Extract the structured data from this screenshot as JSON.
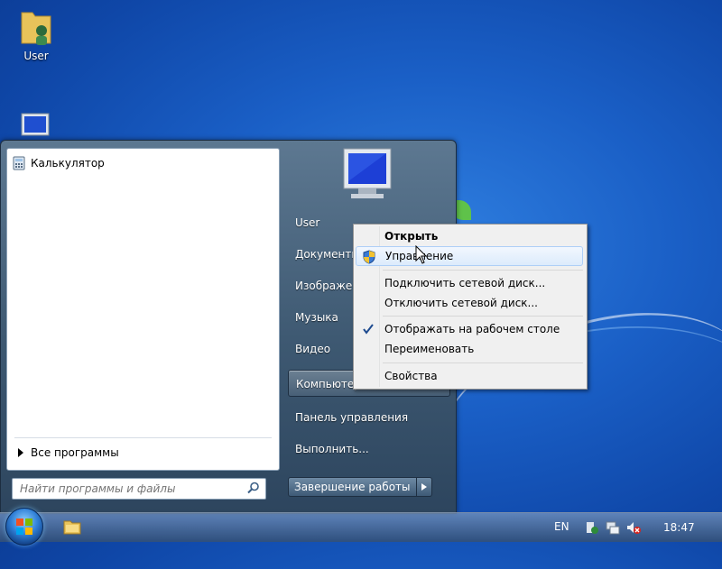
{
  "desktop": {
    "icons": [
      {
        "label": "User",
        "icon": "user-folder-icon"
      },
      {
        "label": "",
        "icon": "computer-icon"
      }
    ]
  },
  "start_menu": {
    "programs": [
      {
        "label": "Калькулятор",
        "icon": "calculator-icon"
      }
    ],
    "all_programs": "Все программы",
    "search_placeholder": "Найти программы и файлы",
    "right_items": [
      {
        "label": "User"
      },
      {
        "label": "Документы"
      },
      {
        "label": "Изображения"
      },
      {
        "label": "Музыка"
      },
      {
        "label": "Видео"
      },
      {
        "label": "Компьютер",
        "selected": true
      },
      {
        "label": "Панель управления"
      },
      {
        "label": "Выполнить..."
      }
    ],
    "shutdown_label": "Завершение работы"
  },
  "context_menu": {
    "items": [
      {
        "label": "Открыть",
        "bold": true
      },
      {
        "label": "Управление",
        "icon": "uac-shield-icon",
        "hovered": true
      },
      {
        "label": "Подключить сетевой диск..."
      },
      {
        "label": "Отключить сетевой диск..."
      },
      {
        "label": "Отображать на рабочем столе",
        "checked": true
      },
      {
        "label": "Переименовать"
      },
      {
        "label": "Свойства"
      }
    ]
  },
  "taskbar": {
    "language": "EN",
    "clock": "18:47",
    "tray_icons": [
      "action-center-icon",
      "network-icon",
      "volume-muted-icon"
    ]
  }
}
